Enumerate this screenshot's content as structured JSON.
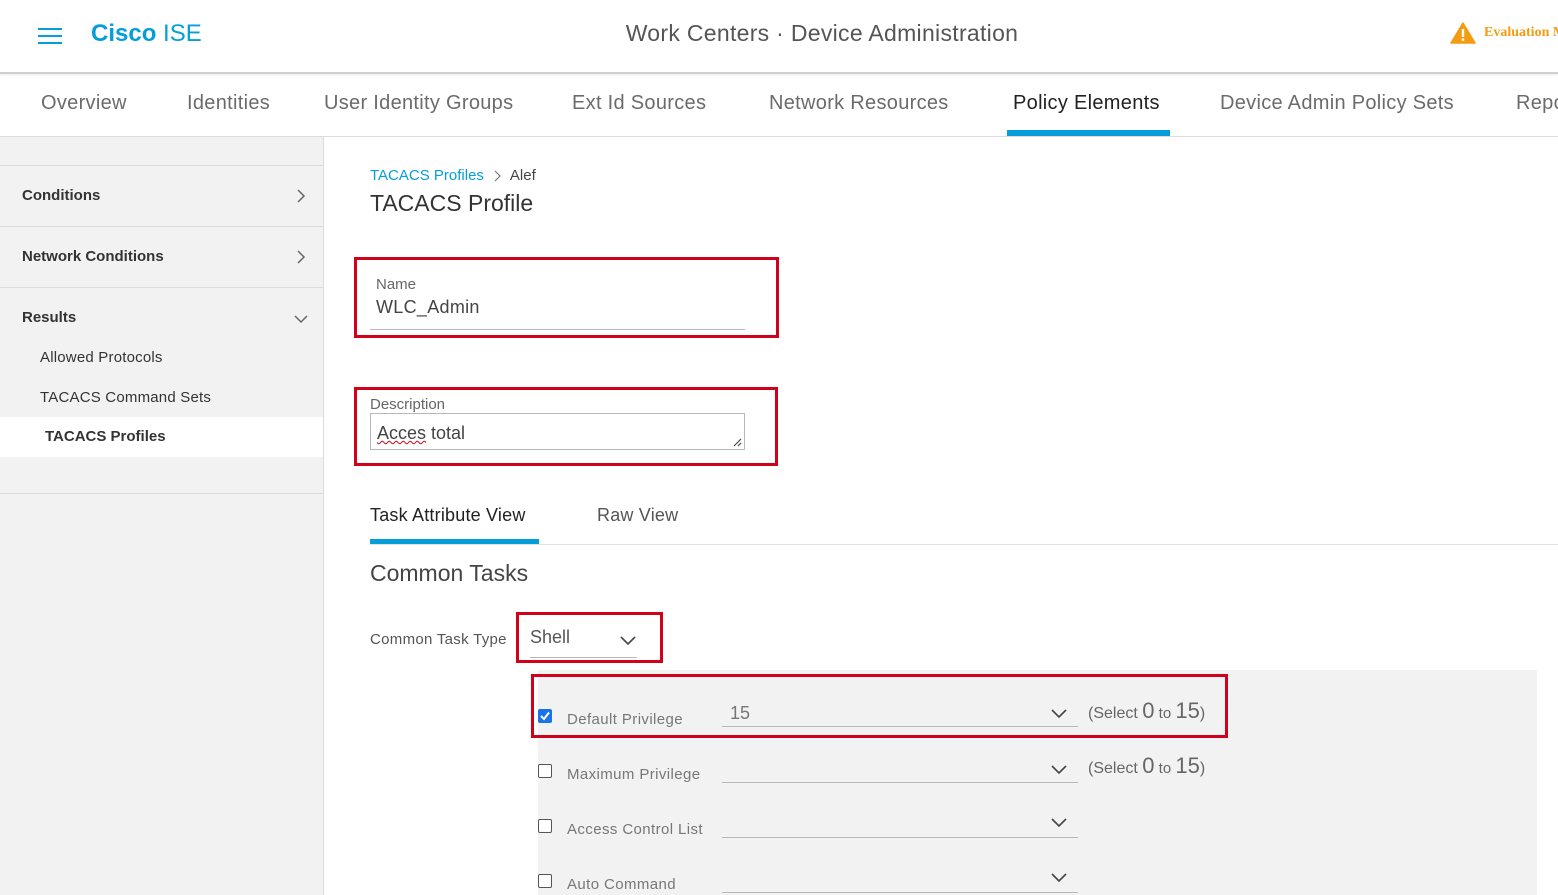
{
  "header": {
    "brand_bold": "Cisco",
    "brand_light": "ISE",
    "title": "Work Centers · Device Administration",
    "evaluation_text": "Evaluation M"
  },
  "topnav": {
    "tabs": [
      "Overview",
      "Identities",
      "User Identity Groups",
      "Ext Id Sources",
      "Network Resources",
      "Policy Elements",
      "Device Admin Policy Sets",
      "Repo"
    ],
    "active": "Policy Elements"
  },
  "sidebar": {
    "conditions": "Conditions",
    "network_conditions": "Network Conditions",
    "results": "Results",
    "results_items": [
      "Allowed Protocols",
      "TACACS Command Sets",
      "TACACS Profiles"
    ],
    "active_item": "TACACS Profiles"
  },
  "breadcrumb": {
    "parent": "TACACS Profiles",
    "current": "Alef"
  },
  "page_title": "TACACS Profile",
  "form": {
    "name_label": "Name",
    "name_value": "WLC_Admin",
    "description_label": "Description",
    "description_word1": "Acces",
    "description_word2": " total"
  },
  "subtabs": {
    "task_attribute_view": "Task Attribute View",
    "raw_view": "Raw View"
  },
  "common_tasks": {
    "title": "Common Tasks",
    "type_label": "Common Task Type",
    "type_value": "Shell"
  },
  "attributes": {
    "default_privilege": {
      "label": "Default Privilege",
      "checked": true,
      "value": "15"
    },
    "maximum_privilege": {
      "label": "Maximum Privilege",
      "checked": false,
      "value": ""
    },
    "access_control_list": {
      "label": "Access Control List",
      "checked": false,
      "value": ""
    },
    "auto_command": {
      "label": "Auto Command",
      "checked": false,
      "value": ""
    },
    "range": {
      "open": "(Select ",
      "min": "0",
      "to": " to ",
      "max": "15",
      "close": ")"
    }
  },
  "colors": {
    "accent": "#049fd9",
    "highlight_box": "#d0021b",
    "warning": "#f39c12",
    "checkbox_checked": "#1a73e8"
  },
  "icons": {
    "menu": "hamburger-menu-icon",
    "warning": "warning-triangle-icon",
    "chevron_right": "chevron-right-icon",
    "chevron_down": "chevron-down-icon",
    "checkmark": "checkmark-icon",
    "resize": "resize-handle-icon"
  }
}
